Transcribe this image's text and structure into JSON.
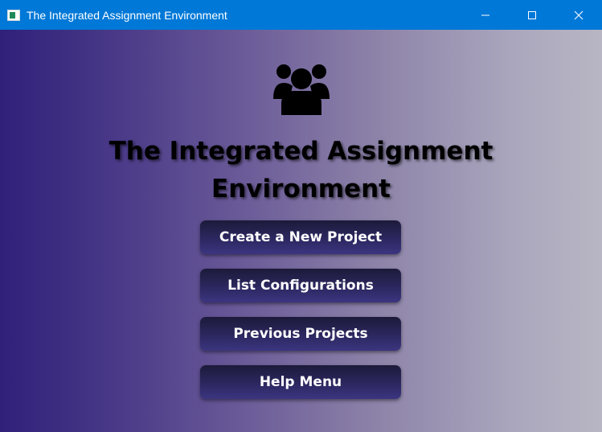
{
  "window": {
    "title": "The Integrated Assignment Environment",
    "controls": [
      "minimize",
      "maximize",
      "close"
    ]
  },
  "main": {
    "icon": "users-group-icon",
    "heading_line1": "The Integrated Assignment",
    "heading_line2": "Environment",
    "buttons": [
      {
        "label": "Create a New Project"
      },
      {
        "label": "List Configurations"
      },
      {
        "label": "Previous Projects"
      },
      {
        "label": "Help Menu"
      }
    ]
  },
  "colors": {
    "titlebar": "#0078d7",
    "gradient_left": "#30207a",
    "gradient_right": "#b8b6c4",
    "button_top": "#1c1a3a",
    "button_bottom": "#3b3580"
  }
}
